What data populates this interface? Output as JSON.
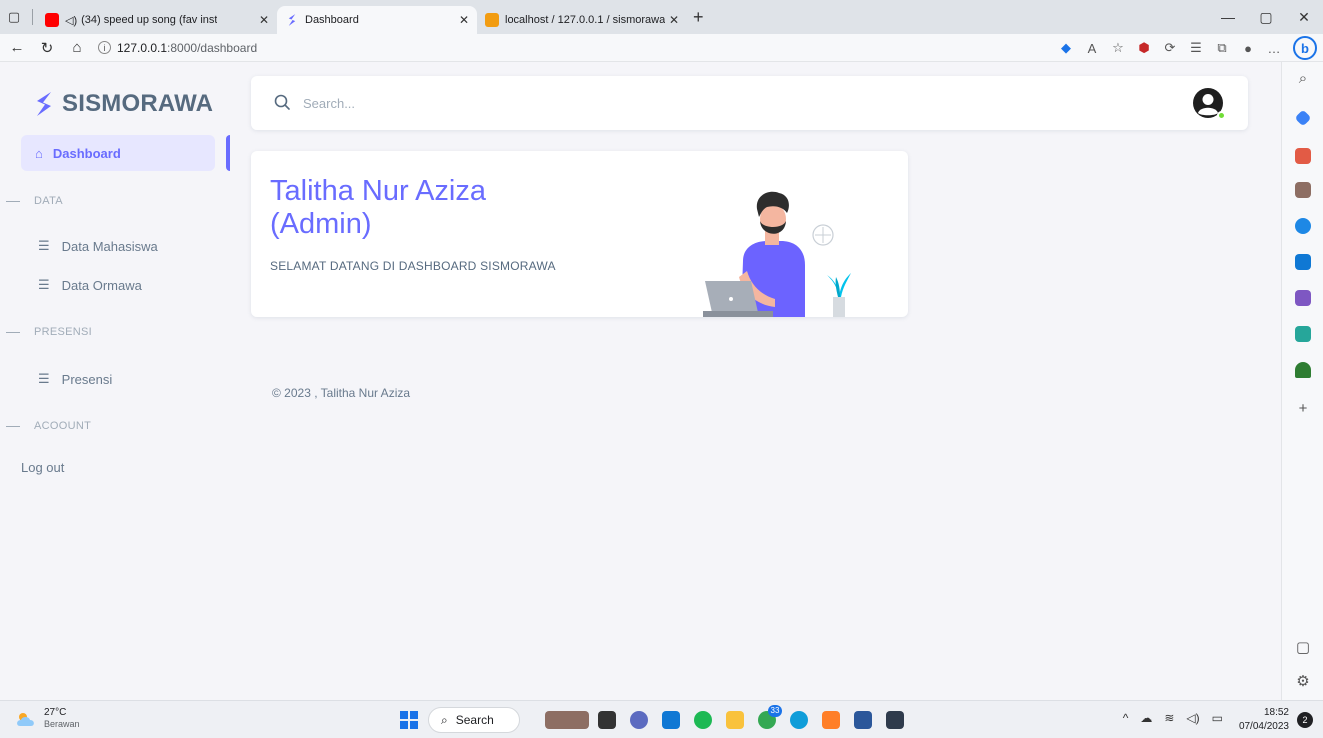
{
  "browser": {
    "tabs": [
      {
        "title": "(34) speed up song (fav inst",
        "active": false
      },
      {
        "title": "Dashboard",
        "active": true
      },
      {
        "title": "localhost / 127.0.0.1 / sismorawa",
        "active": false
      }
    ],
    "url_host": "127.0.0.1",
    "url_path": ":8000/dashboard"
  },
  "sidebar": {
    "brand": "SISMORAWA",
    "active_item": "Dashboard",
    "sections": [
      {
        "header": "DATA",
        "items": [
          "Data Mahasiswa",
          "Data Ormawa"
        ]
      },
      {
        "header": "PRESENSI",
        "items": [
          "Presensi"
        ]
      },
      {
        "header": "ACOOUNT",
        "items": []
      }
    ],
    "logout": "Log out"
  },
  "navbar": {
    "search_placeholder": "Search..."
  },
  "welcome": {
    "title_line1": "Talitha Nur Aziza",
    "title_line2": "(Admin)",
    "subtitle": "SELAMAT DATANG DI DASHBOARD SISMORAWA"
  },
  "footer": "© 2023 , Talitha Nur Aziza",
  "taskbar": {
    "temperature": "27°C",
    "weather": "Berawan",
    "search": "Search",
    "badge": "33",
    "time": "18:52",
    "date": "07/04/2023",
    "notifications": "2"
  },
  "colors": {
    "primary": "#696cff",
    "active_bg": "#e7e7ff",
    "text": "#566a7f",
    "muted": "#a1acb8"
  }
}
